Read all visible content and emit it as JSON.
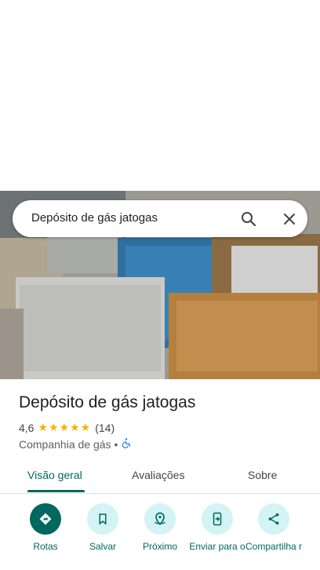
{
  "search": {
    "query": "Depósito de gás jatogas"
  },
  "place": {
    "name": "Depósito de gás jatogas",
    "rating": "4,6",
    "rating_value": 4.6,
    "stars": "★★★★★",
    "review_count": "(14)",
    "category": "Companhia de gás",
    "separator": "•"
  },
  "tabs": [
    {
      "label": "Visão geral",
      "active": true
    },
    {
      "label": "Avaliações",
      "active": false
    },
    {
      "label": "Sobre",
      "active": false
    }
  ],
  "actions": [
    {
      "label": "Rotas",
      "icon": "directions-icon"
    },
    {
      "label": "Salvar",
      "icon": "bookmark-icon"
    },
    {
      "label": "Próximo",
      "icon": "nearby-icon"
    },
    {
      "label": "Enviar para o",
      "icon": "send-to-phone-icon"
    },
    {
      "label": "Compartilha r",
      "icon": "share-icon"
    }
  ],
  "colors": {
    "accent": "#00685e",
    "chip": "#d3f3f5",
    "star": "#f4b400"
  }
}
